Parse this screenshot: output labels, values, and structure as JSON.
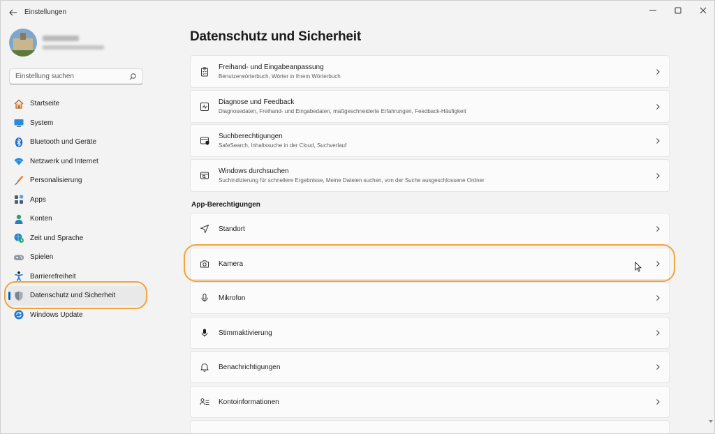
{
  "window": {
    "title": "Einstellungen"
  },
  "search": {
    "placeholder": "Einstellung suchen"
  },
  "sidebar": {
    "items": [
      {
        "label": "Startseite",
        "icon": "home-icon"
      },
      {
        "label": "System",
        "icon": "monitor-icon"
      },
      {
        "label": "Bluetooth und Geräte",
        "icon": "bluetooth-icon"
      },
      {
        "label": "Netzwerk und Internet",
        "icon": "wifi-icon"
      },
      {
        "label": "Personalisierung",
        "icon": "brush-icon"
      },
      {
        "label": "Apps",
        "icon": "apps-icon"
      },
      {
        "label": "Konten",
        "icon": "person-icon"
      },
      {
        "label": "Zeit und Sprache",
        "icon": "globe-clock-icon"
      },
      {
        "label": "Spielen",
        "icon": "gamepad-icon"
      },
      {
        "label": "Barrierefreiheit",
        "icon": "accessibility-icon"
      },
      {
        "label": "Datenschutz und Sicherheit",
        "icon": "shield-icon",
        "active": true
      },
      {
        "label": "Windows Update",
        "icon": "update-icon"
      }
    ]
  },
  "main": {
    "title": "Datenschutz und Sicherheit",
    "cards": [
      {
        "title": "Freihand- und Eingabeanpassung",
        "subtitle": "Benutzerwörterbuch, Wörter in Ihrem Wörterbuch",
        "icon": "clipboard-list-icon"
      },
      {
        "title": "Diagnose und Feedback",
        "subtitle": "Diagnosedaten, Freihand- und Eingabedaten, maßgeschneiderte Erfahrungen, Feedback-Häufigkeit",
        "icon": "pulse-icon"
      },
      {
        "title": "Suchberechtigungen",
        "subtitle": "SafeSearch, Inhaltssuche in der Cloud, Suchverlauf",
        "icon": "search-shield-icon"
      },
      {
        "title": "Windows durchsuchen",
        "subtitle": "Suchindizierung für schnellere Ergebnisse, Meine Dateien suchen, von der Suche ausgeschlossene Ordner",
        "icon": "search-window-icon"
      }
    ],
    "section_app_permissions": "App-Berechtigungen",
    "permissions": [
      {
        "title": "Standort",
        "icon": "location-arrow-icon"
      },
      {
        "title": "Kamera",
        "icon": "camera-icon"
      },
      {
        "title": "Mikrofon",
        "icon": "microphone-icon"
      },
      {
        "title": "Stimmaktivierung",
        "icon": "voice-activation-icon"
      },
      {
        "title": "Benachrichtigungen",
        "icon": "bell-icon"
      },
      {
        "title": "Kontoinformationen",
        "icon": "account-info-icon"
      }
    ]
  },
  "colors": {
    "accent": "#0067c0",
    "highlight": "#f2a33a"
  }
}
